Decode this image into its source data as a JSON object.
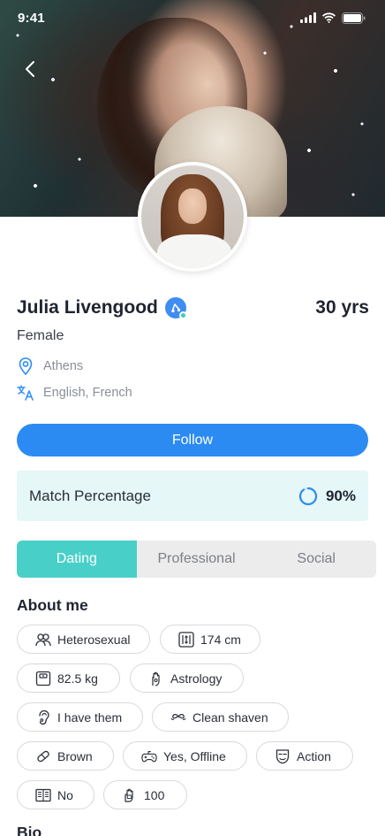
{
  "status_bar": {
    "time": "9:41"
  },
  "profile": {
    "name": "Julia Livengood",
    "age": "30 yrs",
    "gender": "Female",
    "location": "Athens",
    "languages": "English, French"
  },
  "actions": {
    "follow_label": "Follow"
  },
  "match": {
    "label": "Match Percentage",
    "value": "90%",
    "percent": 90
  },
  "tabs": [
    {
      "label": "Dating",
      "active": true
    },
    {
      "label": "Professional",
      "active": false
    },
    {
      "label": "Social",
      "active": false
    }
  ],
  "about": {
    "title": "About me",
    "chips": [
      {
        "icon": "people-icon",
        "label": "Heterosexual"
      },
      {
        "icon": "height-icon",
        "label": "174 cm"
      },
      {
        "icon": "weight-scale-icon",
        "label": "82.5 kg"
      },
      {
        "icon": "astrology-hand-icon",
        "label": "Astrology"
      },
      {
        "icon": "ear-icon",
        "label": "I have them"
      },
      {
        "icon": "mustache-icon",
        "label": "Clean shaven"
      },
      {
        "icon": "hair-band-icon",
        "label": "Brown"
      },
      {
        "icon": "gamepad-icon",
        "label": "Yes, Offline"
      },
      {
        "icon": "mask-icon",
        "label": "Action"
      },
      {
        "icon": "book-icon",
        "label": "No"
      },
      {
        "icon": "rating-hand-icon",
        "label": "100"
      }
    ]
  },
  "bio": {
    "title": "Bio"
  },
  "colors": {
    "accent_blue": "#2b8bf2",
    "accent_teal": "#48d0c8",
    "match_bg": "#e5f7f6",
    "chip_border": "#d6d9de"
  }
}
